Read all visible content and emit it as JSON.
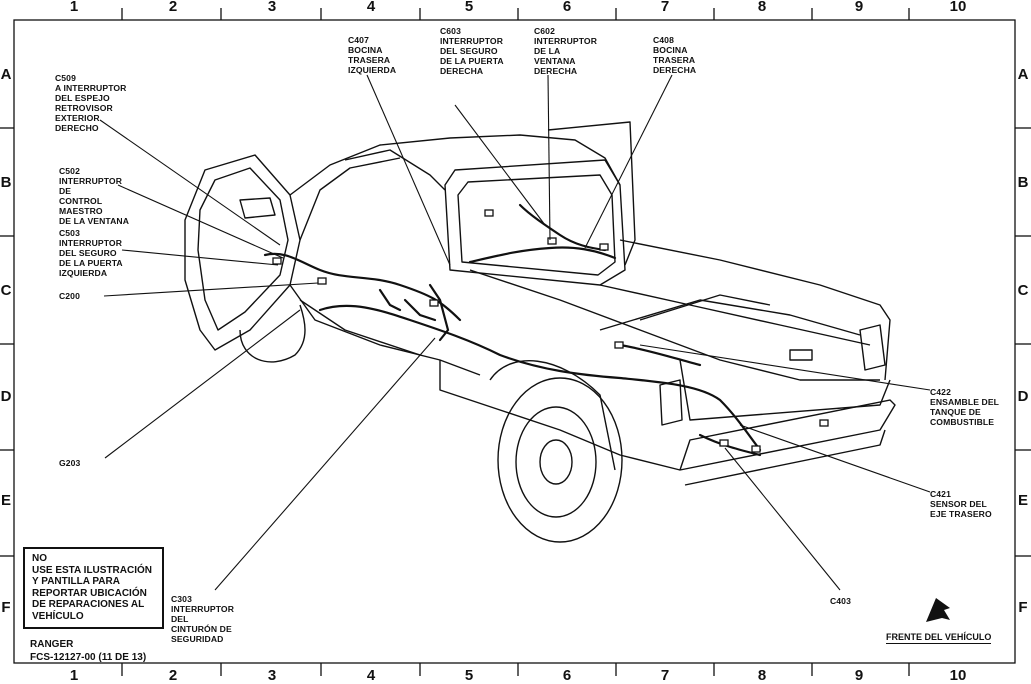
{
  "grid": {
    "columns": [
      "1",
      "2",
      "3",
      "4",
      "5",
      "6",
      "7",
      "8",
      "9",
      "10"
    ],
    "rows": [
      "A",
      "B",
      "C",
      "D",
      "E",
      "F"
    ]
  },
  "callouts": {
    "c509": "C509\nA INTERRUPTOR\nDEL ESPEJO\nRETROVISOR\nEXTERIOR\nDERECHO",
    "c502": "C502\nINTERRUPTOR\nDE\nCONTROL\nMAESTRO\nDE LA VENTANA",
    "c503": "C503\nINTERRUPTOR\nDEL SEGURO\nDE LA PUERTA\nIZQUIERDA",
    "c200": "C200",
    "g203": "G203",
    "c407": "C407\nBOCINA\nTRASERA\nIZQUIERDA",
    "c603": "C603\nINTERRUPTOR\nDEL SEGURO\nDE LA PUERTA\nDERECHA",
    "c602": "C602\nINTERRUPTOR\nDE LA\nVENTANA\nDERECHA",
    "c408": "C408\nBOCINA\nTRASERA\nDERECHA",
    "c422": "C422\nENSAMBLE DEL\nTANQUE DE\nCOMBUSTIBLE",
    "c421": "C421\nSENSOR DEL\nEJE TRASERO",
    "c403": "C403",
    "c303": "C303\nINTERRUPTOR\nDEL\nCINTURÓN DE\nSEGURIDAD"
  },
  "warning": "NO\nUSE ESTA ILUSTRACIÓN\nY PANTILLA PARA\nREPORTAR UBICACIÓN\nDE REPARACIONES AL\nVEHÍCULO",
  "footer": {
    "model": "RANGER",
    "doc_number": "FCS-12127-00 (11 DE 13)",
    "front_label": "FRENTE DEL VEHÍCULO"
  },
  "icons": {
    "front_arrow": "front-of-vehicle-arrow-icon"
  }
}
